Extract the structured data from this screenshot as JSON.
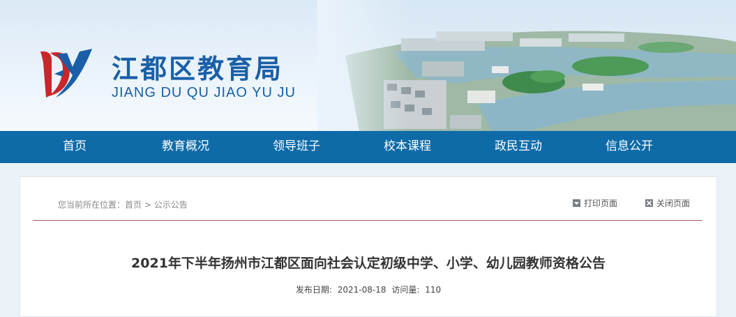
{
  "header": {
    "title": "江都区教育局",
    "subtitle": "JIANG DU QU JIAO YU JU"
  },
  "nav": {
    "items": [
      {
        "label": "首页"
      },
      {
        "label": "教育概况"
      },
      {
        "label": "领导班子"
      },
      {
        "label": "校本课程"
      },
      {
        "label": "政民互动"
      },
      {
        "label": "信息公开"
      }
    ]
  },
  "breadcrumb": {
    "prefix": "您当前所在位置：",
    "home": "首页",
    "separator": ">",
    "current": "公示公告"
  },
  "tools": {
    "print_label": "打印页面",
    "close_label": "关闭页面"
  },
  "article": {
    "title": "2021年下半年扬州市江都区面向社会认定初级中学、小学、幼儿园教师资格公告",
    "date_label": "发布日期:",
    "date": "2021-08-18",
    "views_label": "访问量:",
    "views": "110"
  },
  "colors": {
    "nav_bg": "#0e6ba8",
    "title_blue": "#1a5fa8",
    "logo_red": "#c8262b",
    "divider": "#b55a5a"
  }
}
